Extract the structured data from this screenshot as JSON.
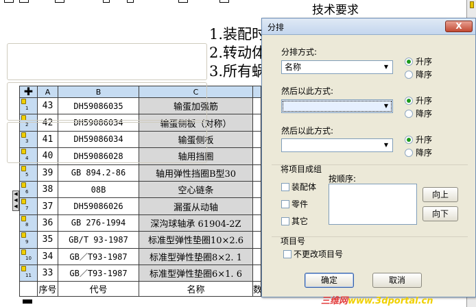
{
  "drawing": {
    "tech_title": "技术要求",
    "tech_lines": [
      "1.装配时",
      "2.转动体",
      "3.所有蜗"
    ],
    "table": {
      "col_headers": [
        "A",
        "B",
        "C"
      ],
      "rows": [
        {
          "idx": "1",
          "a": "43",
          "b": "DH59086035",
          "c": "输蛋加强筋"
        },
        {
          "idx": "2",
          "a": "42",
          "b": "DH59086034",
          "c": "输蛋侧板（对称）"
        },
        {
          "idx": "3",
          "a": "41",
          "b": "DH59086034",
          "c": "输蛋侧板"
        },
        {
          "idx": "4",
          "a": "40",
          "b": "DH59086028",
          "c": "轴用挡圈"
        },
        {
          "idx": "5",
          "a": "39",
          "b": "GB 894.2-86",
          "c": "轴用弹性挡圈B型30"
        },
        {
          "idx": "6",
          "a": "38",
          "b": "08B",
          "c": "空心链条"
        },
        {
          "idx": "7",
          "a": "37",
          "b": "DH59086026",
          "c": "漏蛋从动轴"
        },
        {
          "idx": "8",
          "a": "36",
          "b": "GB 276-1994",
          "c": "深沟球轴承 61904-2Z"
        },
        {
          "idx": "9",
          "a": "35",
          "b": "GB/T 93-1987",
          "c": "标准型弹性垫圈10×2.6"
        },
        {
          "idx": "10",
          "a": "34",
          "b": "GB／T93-1987",
          "c": "标准型弹性垫圈8×2. 1"
        },
        {
          "idx": "11",
          "a": "33",
          "b": "GB／T93-1987",
          "c": "标准型弹性垫圈6×1. 6"
        }
      ],
      "footer": {
        "a": "序号",
        "b": "代号",
        "c": "名称",
        "d": "数"
      }
    }
  },
  "dialog": {
    "title": "分排",
    "close_label": "X",
    "sort1": {
      "label": "分排方式:",
      "value": "名称",
      "asc": "升序",
      "desc": "降序",
      "selected": "asc"
    },
    "sort2": {
      "label": "然后以此方式:",
      "value": "",
      "asc": "升序",
      "desc": "降序",
      "selected": "asc"
    },
    "sort3": {
      "label": "然后以此方式:",
      "value": "",
      "asc": "升序",
      "desc": "降序",
      "selected": "asc"
    },
    "group": {
      "label": "将项目成组",
      "order_label": "按顺序:",
      "assembly": "装配体",
      "part": "零件",
      "other": "其它",
      "move_up": "向上",
      "move_down": "向下"
    },
    "item_number": {
      "label": "项目号",
      "no_change": "不更改项目号"
    },
    "ok": "确定",
    "cancel": "取消"
  },
  "watermark": {
    "part1": "三维网",
    "part2": "www.3dportal.cn"
  }
}
